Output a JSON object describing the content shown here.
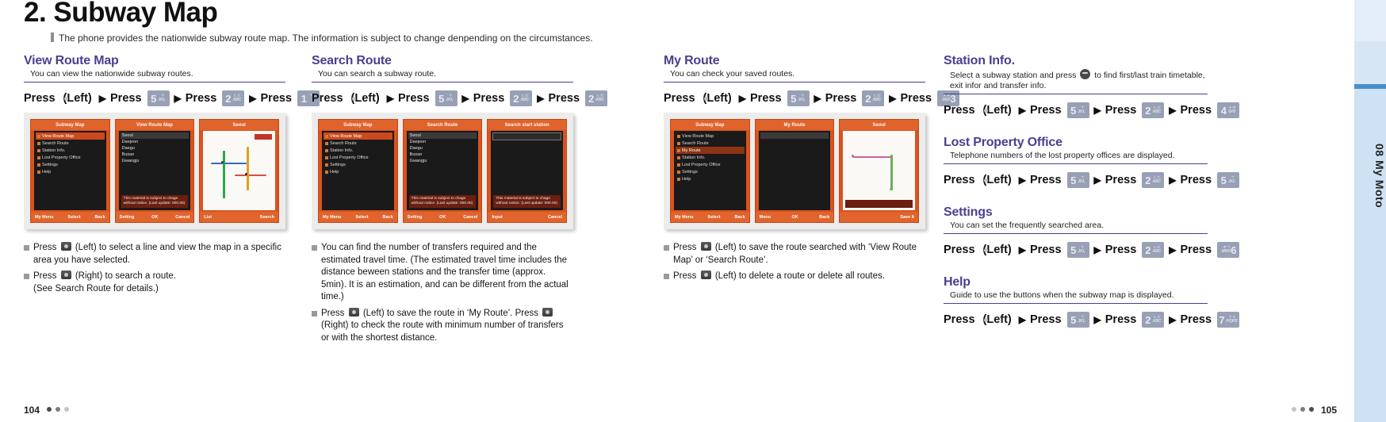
{
  "page": {
    "title": "2. Subway Map",
    "intro": "The phone provides the nationwide subway route map. The information is subject to change denpending on the circumstances.",
    "folio_left": "104",
    "folio_right": "105",
    "side_tab_label": "08 My Moto",
    "accent_color": "#4b3f8f",
    "tab_color": "#cfe2f3"
  },
  "sections": {
    "view_route_map": {
      "title": "View Route Map",
      "subtitle": "You can view the nationwide subway routes.",
      "press": {
        "w1": "Press",
        "k1": "softkey",
        "left": "(Left)",
        "w2": "Press",
        "k2": "5",
        "k2sub_top": "ㄱ",
        "k2sub_bot": "JKL",
        "w3": "Press",
        "k3": "2",
        "k3sub_top": "ㄴㄷ",
        "k3sub_bot": "ABC",
        "w4": "Press",
        "k4": "1",
        "k4sub_top": "ㄱㄴ",
        "k4sub_bot": "··"
      },
      "bullets": [
        "Press  (Left) to select a line and view the map in a specific area you have selected.",
        "Press  (Right) to search a route. (See Search Route for details.)"
      ],
      "bullet_parts": [
        {
          "pre": "Press",
          "key": "softkey",
          "post": "(Left) to select a line and view the map in a specific area you have selected."
        },
        {
          "pre": "Press",
          "key": "softkey",
          "post": "(Right) to search a route.",
          "line2": "(See Search Route for details.)"
        }
      ],
      "shots": [
        {
          "title": "Subway Map",
          "kind": "menu",
          "soft_left": "My Menu",
          "soft_mid": "Select",
          "soft_right": "Back"
        },
        {
          "title": "View Route Map",
          "kind": "lines",
          "soft_left": "Setting",
          "soft_mid": "OK",
          "soft_right": "Cancel"
        },
        {
          "title": "Seoul",
          "kind": "map",
          "soft_left": "List",
          "soft_mid": "",
          "soft_right": "Search"
        }
      ]
    },
    "search_route": {
      "title": "Search Route",
      "subtitle": "You can search a subway route.",
      "press": {
        "w1": "Press",
        "left": "(Left)",
        "w2": "Press",
        "k2": "5",
        "k2sub_top": "ㄱ",
        "k2sub_bot": "JKL",
        "w3": "Press",
        "k3": "2",
        "k3sub_top": "ㄴㄷ",
        "k3sub_bot": "ABC",
        "w4": "Press",
        "k4": "2",
        "k4sub_top": "ㄴㄷ",
        "k4sub_bot": "ABC"
      },
      "bullet_parts": [
        {
          "pre": "",
          "key": "",
          "post": "You can find the number of transfers required and the estimated travel time. (The estimated travel time includes the distance beween stations and the transfer time (approx. 5min). It is an estimation, and can be different from the actual time.)"
        },
        {
          "pre": "Press",
          "key": "softkey",
          "post": "(Left) to save the route in ‘My Route’. Press",
          "key2": "softkey",
          "post2": "(Right) to check the route with minimum number of transfers or with the shortest distance."
        }
      ],
      "shots": [
        {
          "title": "Subway Map",
          "kind": "menu",
          "soft_left": "My Menu",
          "soft_mid": "Select",
          "soft_right": "Back"
        },
        {
          "title": "Search Route",
          "kind": "lines",
          "soft_left": "Setting",
          "soft_mid": "OK",
          "soft_right": "Cancel"
        },
        {
          "title": "Search start station",
          "kind": "search",
          "soft_left": "Input",
          "soft_mid": "",
          "soft_right": "Cancel"
        }
      ]
    },
    "my_route": {
      "title": "My Route",
      "subtitle": "You can check your saved routes.",
      "press": {
        "w1": "Press",
        "left": "(Left)",
        "w2": "Press",
        "k2": "5",
        "k2sub_top": "ㄱ",
        "k2sub_bot": "JKL",
        "w3": "Press",
        "k3": "2",
        "k3sub_top": "ㄴㄷ",
        "k3sub_bot": "ABC",
        "w4": "Press",
        "k4": "3",
        "k4sub_top": "ㅅㅈ",
        "k4sub_bot": "DEF"
      },
      "bullet_parts": [
        {
          "pre": "Press",
          "key": "softkey",
          "post": "(Left) to save the route searched with ‘View Route Map’ or ‘Search Route’."
        },
        {
          "pre": "Press",
          "key": "softkey",
          "post": "(Left) to delete a route or delete all routes."
        }
      ],
      "shots": [
        {
          "title": "Subway Map",
          "kind": "menu",
          "soft_left": "My Menu",
          "soft_mid": "Select",
          "soft_right": "Back"
        },
        {
          "title": "My Route",
          "kind": "myroute",
          "soft_left": "Menu",
          "soft_mid": "OK",
          "soft_right": "Back"
        },
        {
          "title": "Seoul",
          "kind": "routemap",
          "soft_left": "",
          "soft_mid": "",
          "soft_right": "Save It"
        }
      ]
    },
    "station_info": {
      "title": "Station Info.",
      "subtitle_line1": "Select a subway station and press",
      "subtitle_line1b": "to find first/last train timetable,",
      "subtitle_line2": "exit infor and transfer info.",
      "press": {
        "w1": "Press",
        "left": "(Left)",
        "w2": "Press",
        "k2": "5",
        "k2sub_top": "ㄱ",
        "k2sub_bot": "JKL",
        "w3": "Press",
        "k3": "2",
        "k3sub_top": "ㄴㄷ",
        "k3sub_bot": "ABC",
        "w4": "Press",
        "k4": "4",
        "k4sub_top": "ㅅㅂ",
        "k4sub_bot": "GHI"
      }
    },
    "lost_property": {
      "title": "Lost Property Office",
      "subtitle": "Telephone numbers of the lost property offices are displayed.",
      "press": {
        "w1": "Press",
        "left": "(Left)",
        "w2": "Press",
        "k2": "5",
        "k2sub_top": "ㄱ",
        "k2sub_bot": "JKL",
        "w3": "Press",
        "k3": "2",
        "k3sub_top": "ㄴㄷ",
        "k3sub_bot": "ABC",
        "w4": "Press",
        "k4": "5",
        "k4sub_top": "ㄱ",
        "k4sub_bot": "JKL"
      }
    },
    "settings": {
      "title": "Settings",
      "subtitle": "You can set the frequently searched area.",
      "press": {
        "w1": "Press",
        "left": "(Left)",
        "w2": "Press",
        "k2": "5",
        "k2sub_top": "ㄱ",
        "k2sub_bot": "JKL",
        "w3": "Press",
        "k3": "2",
        "k3sub_top": "ㄴㄷ",
        "k3sub_bot": "ABC",
        "w4": "Press",
        "k4": "6",
        "k4sub_top": "ㅎㄱ",
        "k4sub_bot": "MNO"
      }
    },
    "help": {
      "title": "Help",
      "subtitle": "Guide to use the buttons when the subway map is displayed.",
      "press": {
        "w1": "Press",
        "left": "(Left)",
        "w2": "Press",
        "k2": "5",
        "k2sub_top": "ㄱ",
        "k2sub_bot": "JKL",
        "w3": "Press",
        "k3": "2",
        "k3sub_top": "ㄴㄷ",
        "k3sub_bot": "ABC",
        "w4": "Press",
        "k4": "7",
        "k4sub_top": "ㅏㅅ",
        "k4sub_bot": "PQRS"
      }
    }
  },
  "phone_menu_items": [
    "View Route Map",
    "Search Route",
    "Station Info.",
    "Lost Property Office",
    "Settings",
    "Help"
  ],
  "phone_line_items": [
    "Seoul",
    "Daejeon",
    "Daegu",
    "Busan",
    "Gwangju"
  ],
  "phone_note": "This material is subject to chage without notice. (Last update: 000.00)"
}
